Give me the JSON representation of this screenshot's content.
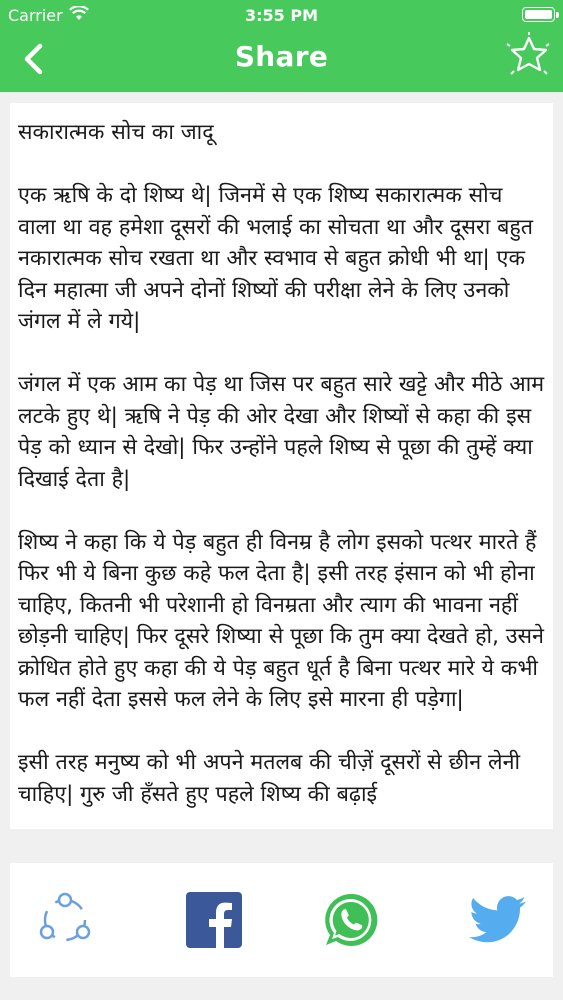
{
  "status_bar": {
    "carrier": "Carrier",
    "time": "3:55 PM"
  },
  "nav": {
    "title": "Share"
  },
  "colors": {
    "header_green": "#47c95b",
    "facebook_blue": "#3b5998",
    "whatsapp_green": "#3fbf55",
    "twitter_blue": "#55acee",
    "share_blue": "#6aa0e0"
  },
  "content": {
    "title": "सकारात्मक सोच का जादू",
    "paragraphs": [
      "एक ऋषि के दो शिष्य थे| जिनमें से एक शिष्य सकारात्मक सोच वाला था वह हमेशा दूसरों की भलाई का सोचता था और दूसरा बहुत नकारात्मक सोच रखता था और स्वभाव से बहुत क्रोधी भी था| एक दिन महात्मा जी अपने दोनों शिष्यों की परीक्षा लेने के लिए उनको जंगल में ले गये|",
      "जंगल में एक आम का पेड़ था जिस पर बहुत सारे खट्टे और मीठे आम लटके हुए थे| ऋषि ने पेड़ की ओर देखा और शिष्यों से कहा की इस पेड़ को ध्यान से देखो| फिर उन्होंने पहले शिष्य से पूछा की तुम्हें क्या दिखाई देता है|",
      "शिष्य ने कहा कि ये पेड़ बहुत ही विनम्र है लोग इसको पत्थर मारते हैं फिर भी ये बिना कुछ कहे फल देता है| इसी तरह इंसान को भी होना चाहिए, कितनी भी परेशानी हो विनम्रता और त्याग की भावना नहीं छोड़नी चाहिए| फिर दूसरे शिष्या से पूछा कि तुम क्या देखते हो, उसने क्रोधित होते हुए कहा की ये पेड़ बहुत धूर्त है बिना पत्थर मारे ये कभी फल नहीं देता इससे फल लेने के लिए इसे मारना ही पड़ेगा|",
      "इसी तरह मनुष्य को भी अपने मतलब की चीज़ें दूसरों से छीन लेनी चाहिए| गुरु जी हँसते हुए पहले शिष्य की बढ़ाई"
    ]
  },
  "share_bar": {
    "buttons": [
      {
        "name": "share-icon"
      },
      {
        "name": "facebook-icon"
      },
      {
        "name": "whatsapp-icon"
      },
      {
        "name": "twitter-icon"
      }
    ]
  }
}
